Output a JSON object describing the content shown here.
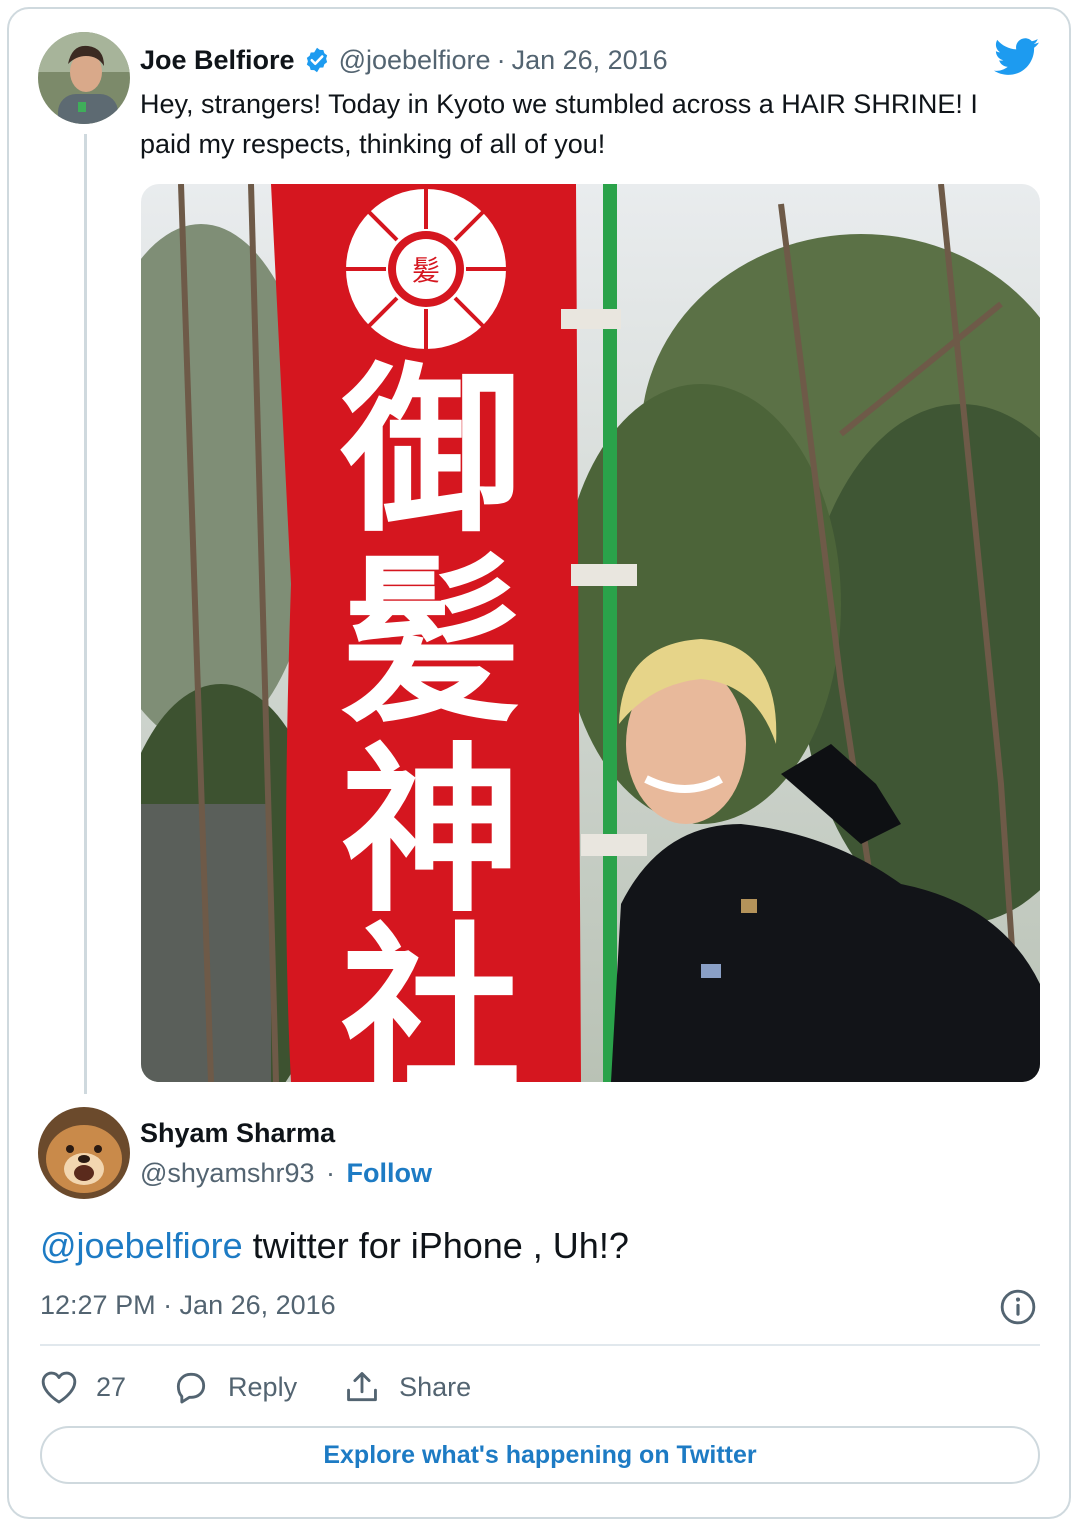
{
  "quoted_tweet": {
    "author_name": "Joe Belfiore",
    "author_handle": "@joebelfiore",
    "separator": "·",
    "date": "Jan 26, 2016",
    "text": "Hey, strangers! Today in Kyoto we stumbled across a HAIR SHRINE! I paid my respects, thinking of all of you!",
    "media": {
      "banner_chars": [
        "御",
        "髪",
        "神",
        "社"
      ],
      "banner_color": "#d5161f"
    }
  },
  "tweet": {
    "author_name": "Shyam Sharma",
    "author_handle": "@shyamshr93",
    "separator": "·",
    "follow_label": "Follow",
    "mention": "@joebelfiore",
    "text": " twitter for iPhone , Uh!?",
    "timestamp": "12:27 PM · Jan 26, 2016"
  },
  "actions": {
    "like_count": "27",
    "reply_label": "Reply",
    "share_label": "Share"
  },
  "explore_label": "Explore what's happening on Twitter",
  "colors": {
    "twitter_blue": "#1d9bf0",
    "link_blue": "#1d7bc4",
    "muted_text": "#536471",
    "border": "#cfd9de"
  },
  "icons": [
    "verified-badge-icon",
    "twitter-bird-icon",
    "info-icon",
    "heart-icon",
    "reply-bubble-icon",
    "share-icon"
  ]
}
